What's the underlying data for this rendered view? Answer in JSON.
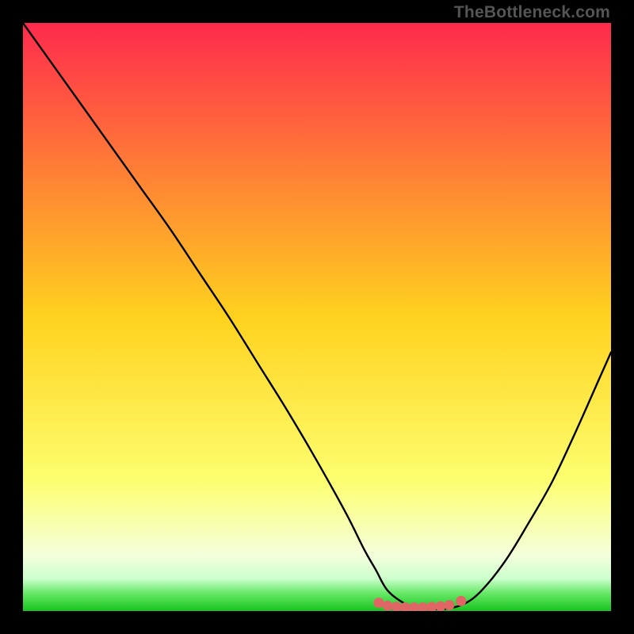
{
  "watermark": "TheBottleneck.com",
  "chart_data": {
    "type": "line",
    "title": "",
    "xlabel": "",
    "ylabel": "",
    "xlim": [
      0,
      100
    ],
    "ylim": [
      0,
      100
    ],
    "x": [
      0,
      5,
      10,
      15,
      20,
      25,
      30,
      35,
      40,
      45,
      50,
      55,
      58,
      60,
      62,
      65,
      67,
      70,
      72,
      75,
      78,
      82,
      86,
      90,
      94,
      98,
      100
    ],
    "y": [
      100,
      93,
      86,
      79,
      72,
      65,
      57.5,
      50,
      42,
      34,
      25.5,
      16.5,
      10.5,
      7,
      3.5,
      1.2,
      0.5,
      0.3,
      0.4,
      1.2,
      3.5,
      8.5,
      15,
      22,
      30.5,
      39.5,
      44
    ],
    "marker_points": [
      {
        "x": 60.5,
        "y": 1.4
      },
      {
        "x": 62.0,
        "y": 0.9
      },
      {
        "x": 63.5,
        "y": 0.7
      },
      {
        "x": 65.0,
        "y": 0.6
      },
      {
        "x": 66.5,
        "y": 0.6
      },
      {
        "x": 68.0,
        "y": 0.6
      },
      {
        "x": 69.5,
        "y": 0.7
      },
      {
        "x": 71.0,
        "y": 0.8
      },
      {
        "x": 72.5,
        "y": 1.0
      },
      {
        "x": 74.5,
        "y": 1.7
      }
    ],
    "marker_color": "#e06666",
    "marker_radius_px": 6.5,
    "gradient_stops": [
      {
        "offset": 0.0,
        "color": "#ff2a4d"
      },
      {
        "offset": 0.5,
        "color": "#ffd21e"
      },
      {
        "offset": 0.78,
        "color": "#fdff70"
      },
      {
        "offset": 0.905,
        "color": "#f4ffdc"
      },
      {
        "offset": 0.945,
        "color": "#ccffcc"
      },
      {
        "offset": 0.97,
        "color": "#66e866"
      },
      {
        "offset": 1.0,
        "color": "#17c41f"
      }
    ]
  }
}
